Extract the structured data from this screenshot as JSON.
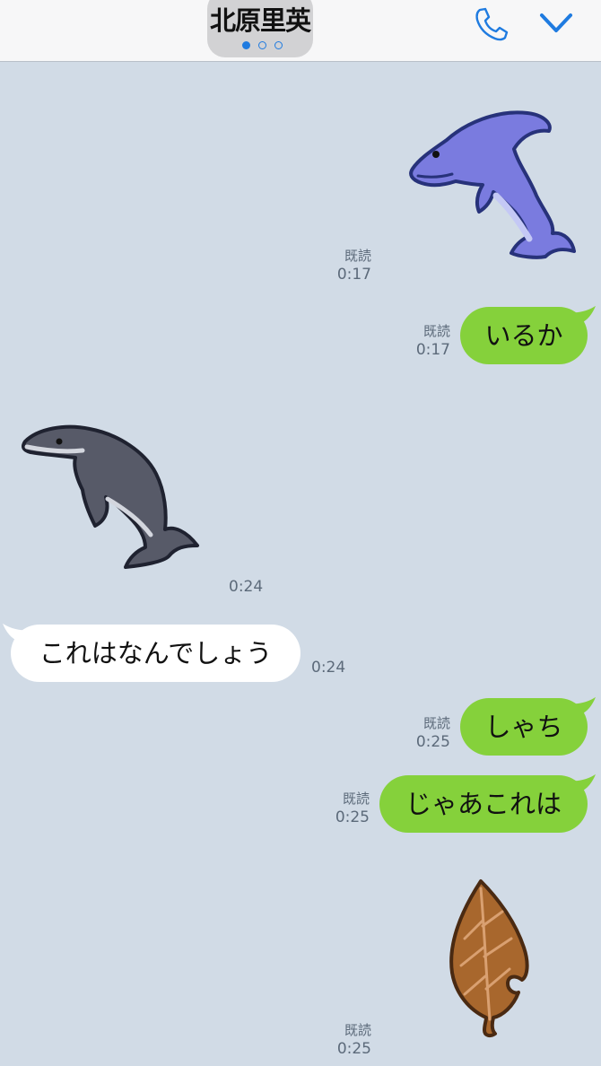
{
  "header": {
    "contact_name": "北原里英",
    "page_indicator": "page 1 of 3",
    "call_icon": "phone-icon",
    "menu_icon": "chevron-down-icon",
    "accent_color": "#1f7be0"
  },
  "messages": [
    {
      "type": "sticker",
      "direction": "outgoing",
      "sticker": "purple-dolphin-icon",
      "read_label": "既読",
      "time": "0:17"
    },
    {
      "type": "text",
      "direction": "outgoing",
      "text": "いるか",
      "read_label": "既読",
      "time": "0:17"
    },
    {
      "type": "sticker",
      "direction": "incoming",
      "sticker": "gray-whale-icon",
      "time": "0:24"
    },
    {
      "type": "text",
      "direction": "incoming",
      "text": "これはなんでしょう",
      "time": "0:24"
    },
    {
      "type": "text",
      "direction": "outgoing",
      "text": "しゃち",
      "read_label": "既読",
      "time": "0:25"
    },
    {
      "type": "text",
      "direction": "outgoing",
      "text": "じゃあこれは",
      "read_label": "既読",
      "time": "0:25"
    },
    {
      "type": "sticker",
      "direction": "outgoing",
      "sticker": "brown-leaf-icon",
      "read_label": "既読",
      "time": "0:25"
    }
  ],
  "colors": {
    "chat_background": "#d1dbe6",
    "outgoing_bubble": "#85d13b",
    "incoming_bubble": "#ffffff",
    "meta_text": "#5c6a7a"
  }
}
